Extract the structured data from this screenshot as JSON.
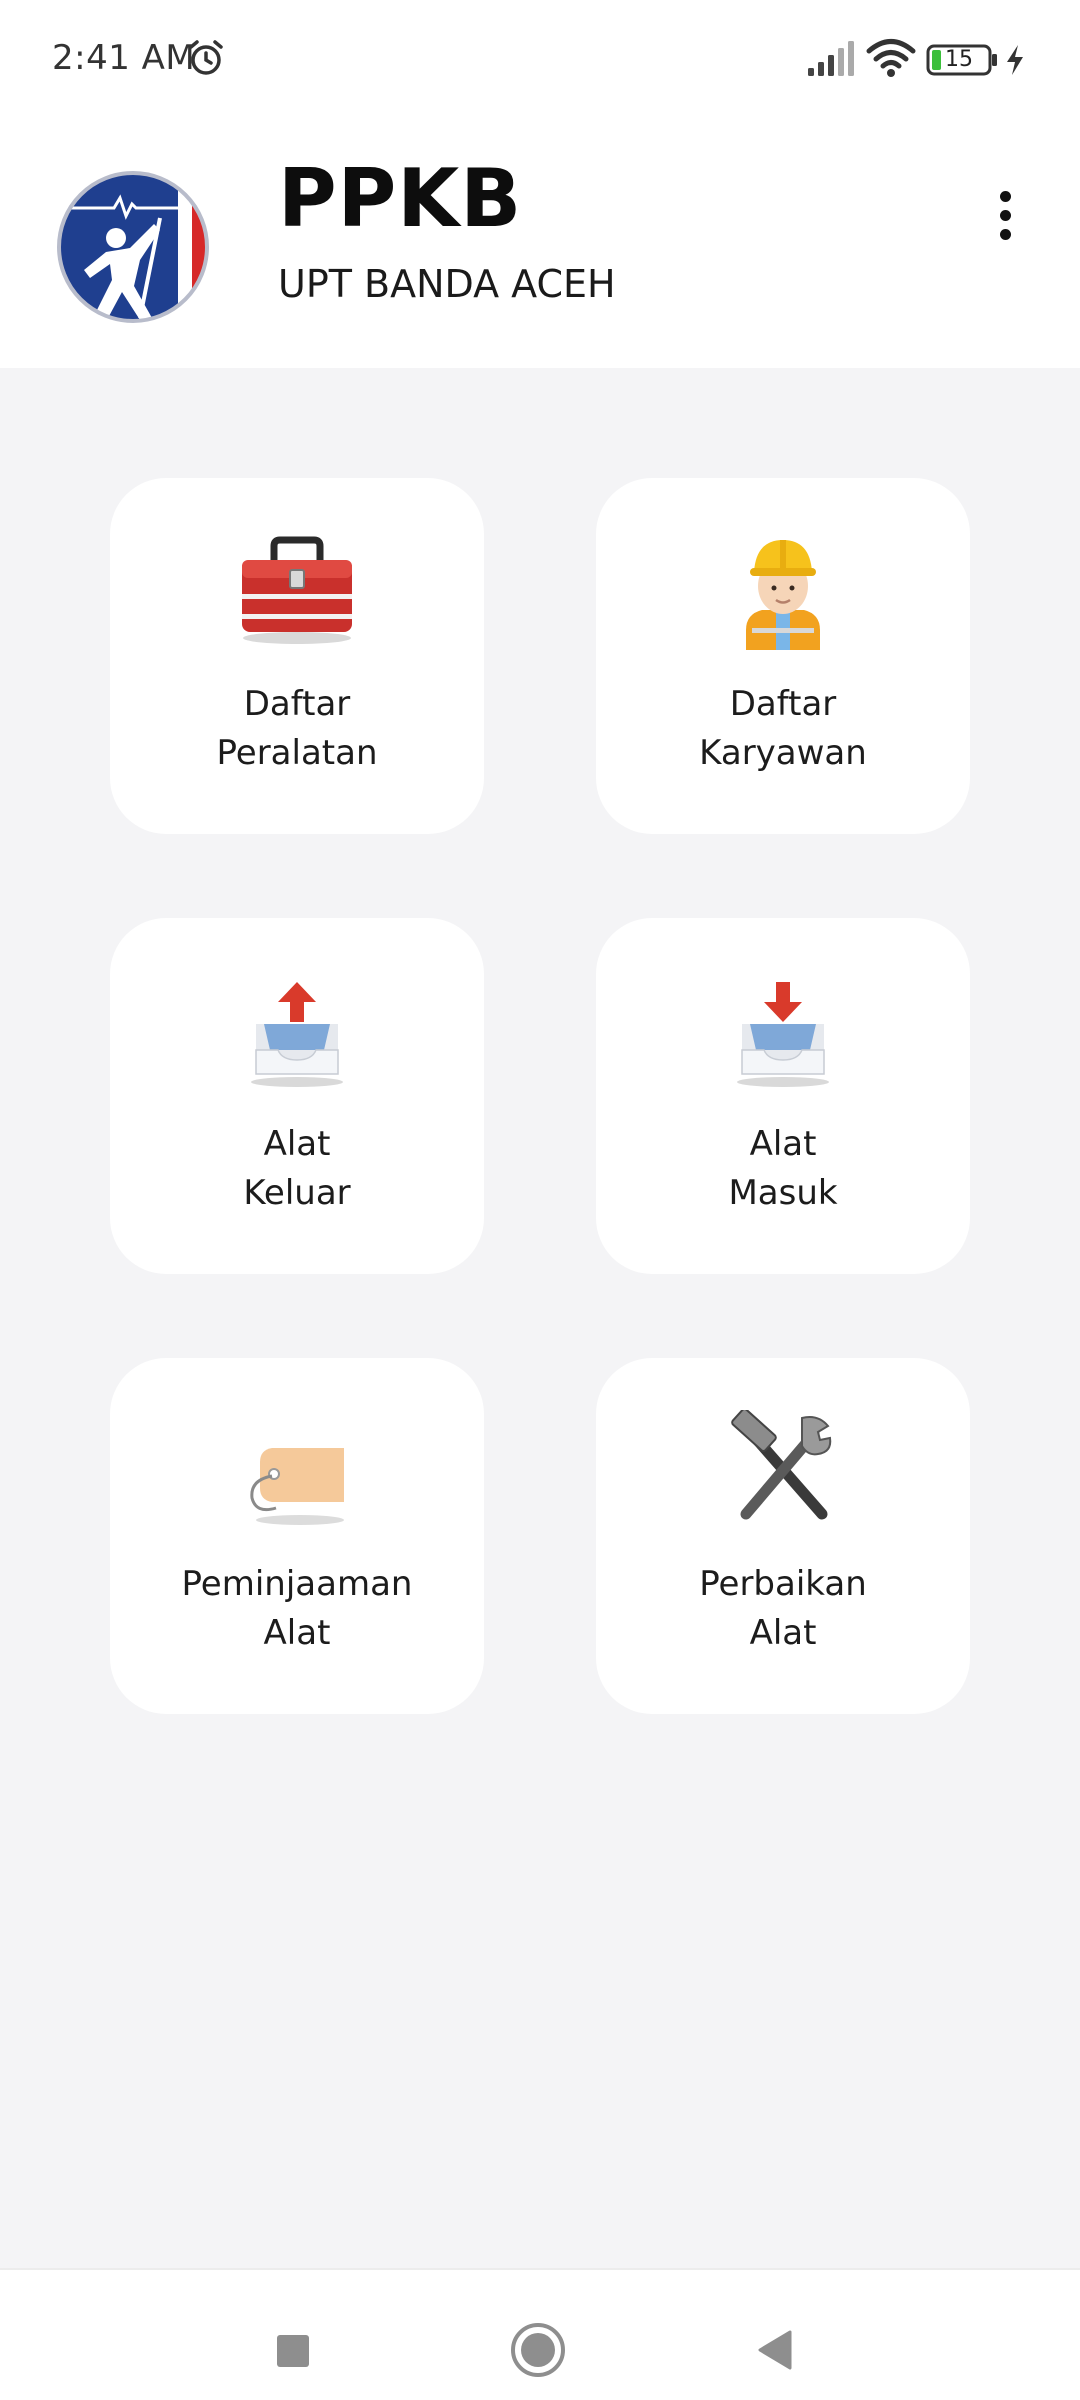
{
  "status_bar": {
    "time": "2:41 AM",
    "battery_level": "15",
    "icons": [
      "alarm-icon",
      "signal-icon",
      "wifi-icon",
      "battery-icon",
      "charging-icon"
    ]
  },
  "header": {
    "title": "PPKB",
    "subtitle": "UPT BANDA ACEH",
    "logo_icon": "pln-lineman-logo",
    "menu_icon": "overflow-menu-icon"
  },
  "menu": [
    {
      "line1": "Daftar",
      "line2": "Peralatan",
      "icon": "toolbox-icon"
    },
    {
      "line1": "Daftar",
      "line2": "Karyawan",
      "icon": "construction-worker-icon"
    },
    {
      "line1": "Alat",
      "line2": "Keluar",
      "icon": "outbox-tray-icon"
    },
    {
      "line1": "Alat",
      "line2": "Masuk",
      "icon": "inbox-tray-icon"
    },
    {
      "line1": "Peminjaaman",
      "line2": "Alat",
      "icon": "tag-label-icon"
    },
    {
      "line1": "Perbaikan",
      "line2": "Alat",
      "icon": "hammer-wrench-icon"
    }
  ],
  "nav_bar": {
    "icons": [
      "recent-apps-icon",
      "home-icon",
      "back-icon"
    ]
  },
  "colors": {
    "background": "#f4f4f6",
    "card": "#ffffff",
    "logo_blue": "#1f3f8f",
    "logo_red": "#d62828"
  }
}
